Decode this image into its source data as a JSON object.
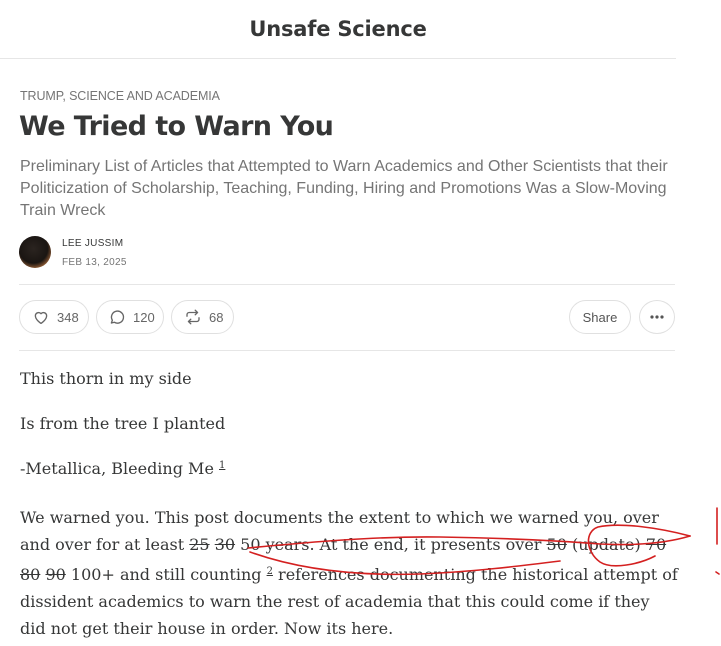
{
  "header": {
    "site_title": "Unsafe Science"
  },
  "post": {
    "category": "TRUMP, SCIENCE AND ACADEMIA",
    "title": "We Tried to Warn You",
    "subtitle": "Preliminary List of Articles that Attempted to Warn Academics and Other Scientists that their Politicization of Scholarship, Teaching, Funding, Hiring and Promotions Was a Slow-Moving Train Wreck",
    "author": "LEE JUSSIM",
    "date": "FEB 13, 2025"
  },
  "actions": {
    "likes": "348",
    "comments": "120",
    "restacks": "68",
    "share_label": "Share",
    "icons": [
      "heart-icon",
      "comment-icon",
      "restack-icon",
      "more-icon"
    ]
  },
  "body": {
    "line1": "This thorn in my side",
    "line2": "Is from the tree I planted",
    "line3": "-Metallica, Bleeding Me",
    "footnote1": "1",
    "p4": {
      "a": "We warned you. This post documents the extent to which we warned you, over and over for at least ",
      "s1": "25",
      "s2": "30",
      "b": "50 years. At the end, it presents over ",
      "s3": "50",
      "c": "(update) ",
      "s4": "70",
      "s5": "80",
      "s6": "90",
      "d": "100+ and still counting ",
      "footnote2": "2",
      "e": " references documenting the historical attempt of dissident academics to warn the rest of academia that this could come if they did not get their house in order. Now its here."
    }
  },
  "annotation_color": "#d42020"
}
